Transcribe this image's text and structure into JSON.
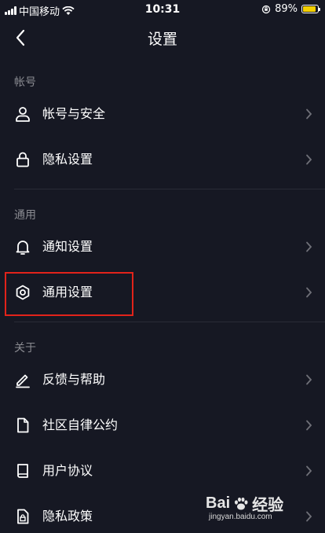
{
  "status_bar": {
    "carrier": "中国移动",
    "time": "10:31",
    "battery_percent": "89%",
    "battery_level": 0.89,
    "icons": [
      "signal-icon",
      "wifi-icon",
      "rotation-lock-icon",
      "battery-icon"
    ]
  },
  "nav": {
    "title": "设置",
    "back_icon": "back-chevron-icon"
  },
  "sections": [
    {
      "header": "帐号",
      "items": [
        {
          "label": "帐号与安全",
          "icon": "user-icon"
        },
        {
          "label": "隐私设置",
          "icon": "lock-icon"
        }
      ]
    },
    {
      "header": "通用",
      "items": [
        {
          "label": "通知设置",
          "icon": "bell-icon"
        },
        {
          "label": "通用设置",
          "icon": "gear-icon"
        }
      ]
    },
    {
      "header": "关于",
      "items": [
        {
          "label": "反馈与帮助",
          "icon": "pencil-icon"
        },
        {
          "label": "社区自律公约",
          "icon": "document-icon"
        },
        {
          "label": "用户协议",
          "icon": "book-icon"
        },
        {
          "label": "隐私政策",
          "icon": "lock-document-icon"
        }
      ]
    }
  ],
  "watermark": {
    "logo_text": "Bai",
    "logo_suffix": "经验",
    "url": "jingyan.baidu.com"
  },
  "colors": {
    "background": "#161823",
    "text": "#ffffff",
    "section_header": "#8a8b91",
    "divider": "#2a2c37",
    "highlight": "#e2231a",
    "battery": "#f5d000"
  }
}
